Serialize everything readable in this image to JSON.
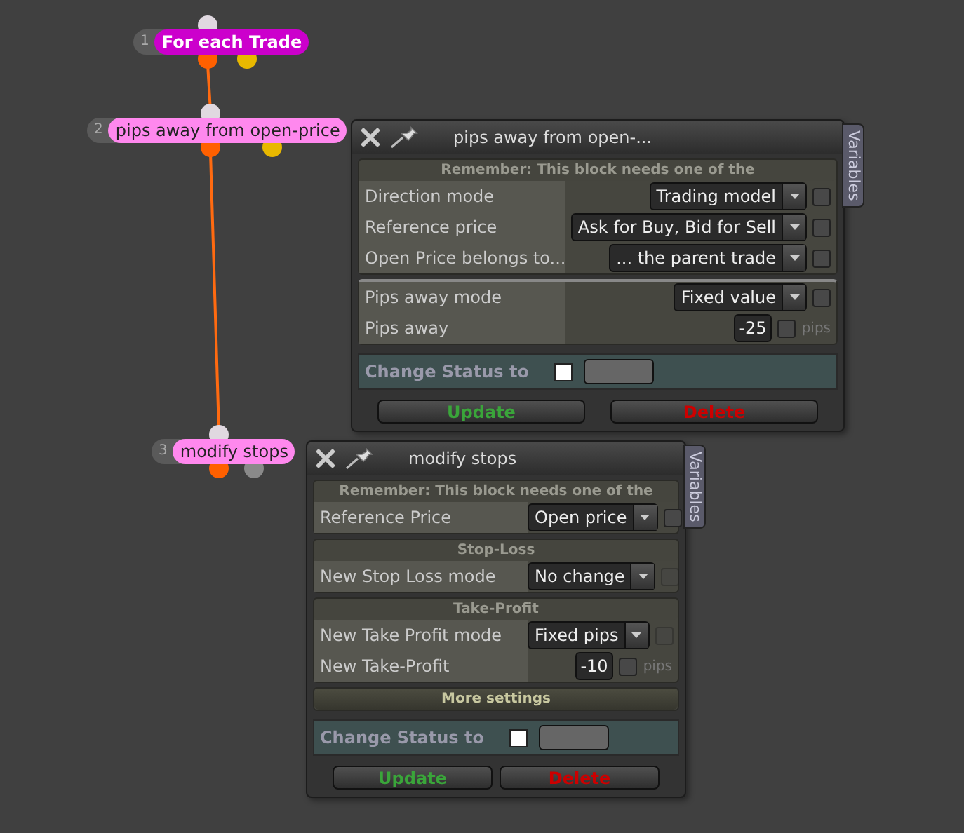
{
  "nodes": [
    {
      "number": "1",
      "label": "For each Trade",
      "color": "#cc00cc",
      "second_port": {
        "color": "#e8b800"
      }
    },
    {
      "number": "2",
      "label": "pips away from open-price",
      "color": "#ff88ee",
      "second_port": {
        "color": "#e8b800"
      }
    },
    {
      "number": "3",
      "label": "modify stops",
      "color": "#ff88ee",
      "second_port": {
        "color": "#8a8a8a"
      }
    }
  ],
  "panels": [
    {
      "title": "pips away from open-...",
      "side_tab": "Variables",
      "sections": [
        {
          "kind": "group",
          "header": "Remember: This block needs one of the",
          "rows": [
            {
              "kind": "select",
              "label": "Direction mode",
              "value": "Trading model",
              "checked": false,
              "checkbox_disabled": false
            },
            {
              "kind": "select",
              "label": "Reference price",
              "value": "Ask for Buy, Bid for Sell",
              "checked": false,
              "checkbox_disabled": false
            },
            {
              "kind": "select",
              "label": "Open Price belongs to...",
              "value": "... the parent trade",
              "checked": false,
              "checkbox_disabled": false
            }
          ]
        },
        {
          "kind": "group",
          "rows": [
            {
              "kind": "select",
              "label": "Pips away mode",
              "value": "Fixed value",
              "checked": false,
              "checkbox_disabled": false
            },
            {
              "kind": "number",
              "label": "Pips away",
              "value": "-25",
              "unit": "pips",
              "checked": false,
              "checkbox_disabled": false
            }
          ]
        }
      ],
      "status": {
        "label": "Change Status to",
        "checked": false
      },
      "buttons": [
        {
          "label": "Update",
          "kind": "update"
        },
        {
          "label": "Delete",
          "kind": "delete"
        }
      ]
    },
    {
      "title": "modify stops",
      "side_tab": "Variables",
      "sections": [
        {
          "kind": "group",
          "header": "Remember: This block needs one of the",
          "rows": [
            {
              "kind": "select",
              "label": "Reference Price",
              "value": "Open price",
              "checked": false,
              "checkbox_disabled": false
            }
          ]
        },
        {
          "kind": "group",
          "header": "Stop-Loss",
          "rows": [
            {
              "kind": "select",
              "label": "New Stop Loss mode",
              "value": "No change",
              "checked": false,
              "checkbox_disabled": true
            }
          ]
        },
        {
          "kind": "group",
          "header": "Take-Profit",
          "rows": [
            {
              "kind": "select",
              "label": "New Take Profit mode",
              "value": "Fixed pips",
              "checked": false,
              "checkbox_disabled": true
            },
            {
              "kind": "number",
              "label": "New Take-Profit",
              "value": "-10",
              "unit": "pips",
              "checked": false,
              "checkbox_disabled": false
            }
          ]
        },
        {
          "kind": "toggle",
          "header": "More settings"
        }
      ],
      "status": {
        "label": "Change Status to",
        "checked": false
      },
      "buttons": [
        {
          "label": "Update",
          "kind": "update"
        },
        {
          "label": "Delete",
          "kind": "delete"
        }
      ]
    }
  ]
}
